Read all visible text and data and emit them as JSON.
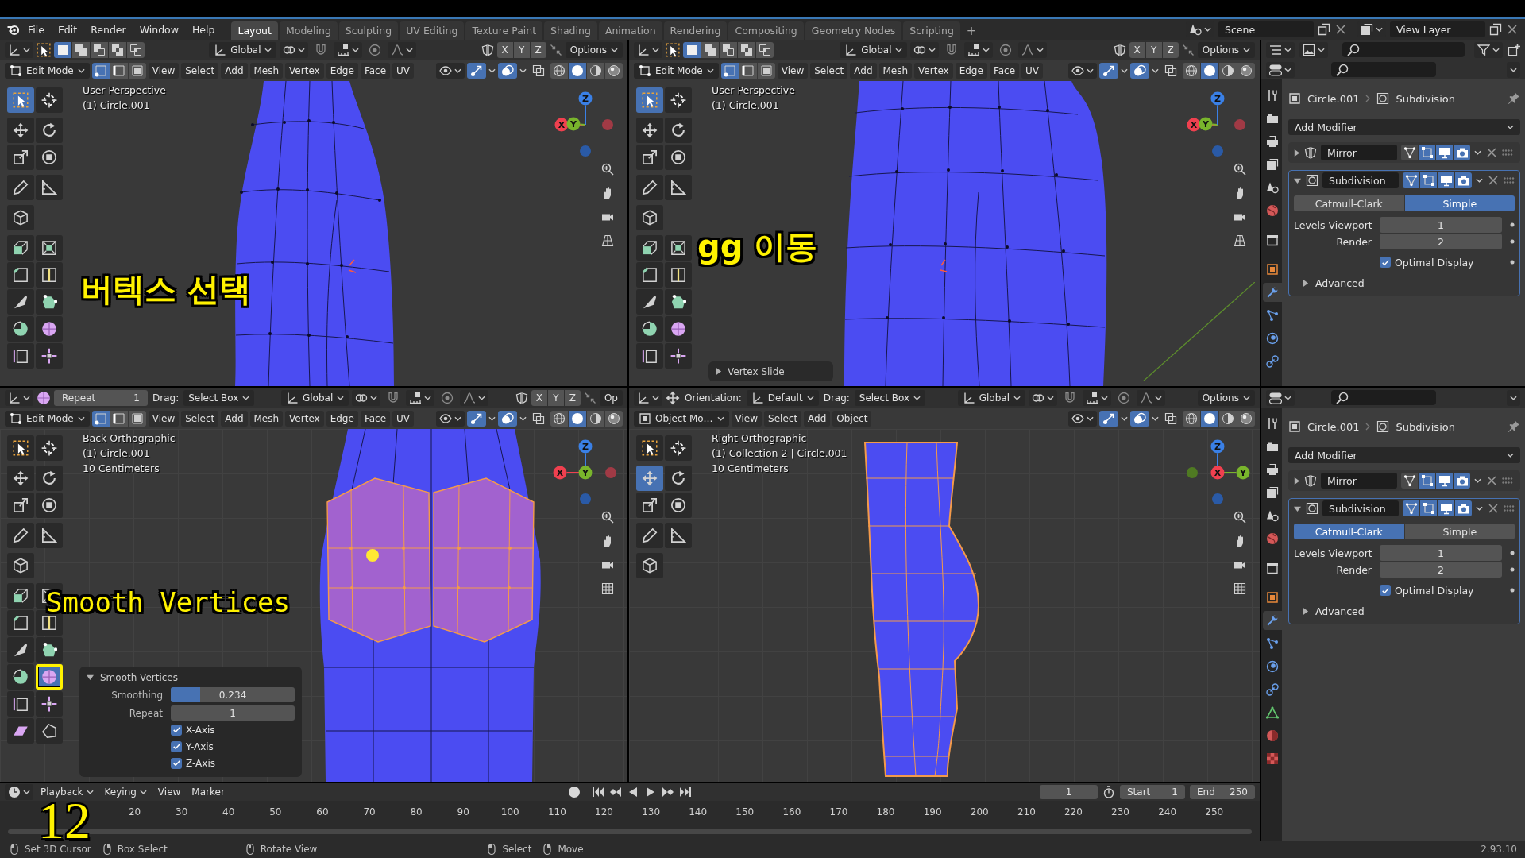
{
  "top_bar": {
    "menus": [
      "File",
      "Edit",
      "Render",
      "Window",
      "Help"
    ],
    "workspaces": [
      {
        "label": "Layout",
        "selected": true
      },
      {
        "label": "Modeling",
        "selected": false
      },
      {
        "label": "Sculpting",
        "selected": false
      },
      {
        "label": "UV Editing",
        "selected": false
      },
      {
        "label": "Texture Paint",
        "selected": false
      },
      {
        "label": "Shading",
        "selected": false
      },
      {
        "label": "Animation",
        "selected": false
      },
      {
        "label": "Rendering",
        "selected": false
      },
      {
        "label": "Compositing",
        "selected": false
      },
      {
        "label": "Geometry Nodes",
        "selected": false
      },
      {
        "label": "Scripting",
        "selected": false
      }
    ],
    "add_workspace": "+",
    "scene": "Scene",
    "view_layer": "View Layer"
  },
  "viewports": [
    {
      "kind": "perspective",
      "tool_settings": {
        "left": [
          {
            "kind": "editor"
          },
          {
            "kind": "tool"
          },
          {
            "kind": "select_set",
            "items": [
              {
                "kind": "set",
                "selected": true
              },
              {
                "kind": "extend",
                "selected": false
              },
              {
                "kind": "subtract",
                "selected": false
              },
              {
                "kind": "invert",
                "selected": false
              },
              {
                "kind": "intersect",
                "selected": false
              }
            ]
          }
        ],
        "center": [
          {
            "kind": "orientation",
            "text": "Global"
          },
          {
            "kind": "pivot"
          },
          {
            "kind": "snap",
            "on": false
          },
          {
            "kind": "proportional",
            "on": false
          }
        ],
        "right": [
          {
            "kind": "mirror"
          },
          {
            "kind": "axes",
            "items": [
              {
                "label": "X",
                "on": false
              },
              {
                "label": "Y",
                "on": false
              },
              {
                "label": "Z",
                "on": false
              }
            ]
          },
          {
            "kind": "auto_merge"
          },
          {
            "kind": "dropdown",
            "text": "Options"
          }
        ]
      },
      "header": {
        "mode": {
          "kind": "edit",
          "text": "Edit Mode"
        },
        "select_modes": [
          {
            "kind": "vertex",
            "selected": true
          },
          {
            "kind": "edge",
            "selected": false
          },
          {
            "kind": "face",
            "selected": false
          }
        ],
        "menus": [
          "View",
          "Select",
          "Add",
          "Mesh",
          "Vertex",
          "Edge",
          "Face",
          "UV"
        ],
        "toggles": [
          {
            "kind": "gizmo",
            "on": true
          },
          {
            "kind": "overlays",
            "on": true
          },
          {
            "kind": "xray",
            "on": false
          }
        ],
        "shading": [
          {
            "kind": "wireframe",
            "selected": false
          },
          {
            "kind": "solid",
            "selected": true
          },
          {
            "kind": "material",
            "selected": false
          },
          {
            "kind": "rendered",
            "selected": false
          }
        ]
      },
      "info": [
        "User Perspective",
        "(1) Circle.001"
      ],
      "gizmo": [
        {
          "kind": "neg_z",
          "color": "#2a5aa6"
        },
        {
          "kind": "neg_x",
          "color": "#a03a45"
        },
        {
          "kind": "x",
          "label": "X",
          "color": "#f0404f"
        },
        {
          "kind": "y",
          "label": "Y",
          "color": "#79b52c"
        },
        {
          "kind": "z",
          "label": "Z",
          "color": "#3a80e6"
        }
      ],
      "tools": [
        {
          "kind": "select",
          "selected": true
        },
        {
          "kind": "cursor",
          "selected": false
        },
        {
          "kind": "move",
          "selected": false
        },
        {
          "kind": "rotate",
          "selected": false
        },
        {
          "kind": "scale",
          "selected": false
        },
        {
          "kind": "transform",
          "selected": false
        },
        {
          "kind": "annotate",
          "selected": false
        },
        {
          "kind": "measure",
          "selected": false
        },
        {
          "kind": "add_cube",
          "selected": false
        },
        {
          "kind": "extrude",
          "selected": false
        },
        {
          "kind": "inset",
          "selected": false
        },
        {
          "kind": "bevel",
          "selected": false
        },
        {
          "kind": "loop_cut",
          "selected": false
        },
        {
          "kind": "knife",
          "selected": false
        },
        {
          "kind": "poly_build",
          "selected": false
        },
        {
          "kind": "spin",
          "selected": false
        },
        {
          "kind": "smooth",
          "selected": false
        },
        {
          "kind": "edge_slide",
          "selected": false
        },
        {
          "kind": "shrink",
          "selected": false
        }
      ],
      "caption": "버텍스 선택"
    },
    {
      "kind": "perspective",
      "tool_settings": {
        "left": [
          {
            "kind": "editor"
          },
          {
            "kind": "tool"
          },
          {
            "kind": "select_set",
            "items": [
              {
                "kind": "set",
                "selected": true
              },
              {
                "kind": "extend",
                "selected": false
              },
              {
                "kind": "subtract",
                "selected": false
              },
              {
                "kind": "invert",
                "selected": false
              },
              {
                "kind": "intersect",
                "selected": false
              }
            ]
          }
        ],
        "center": [
          {
            "kind": "orientation",
            "text": "Global"
          },
          {
            "kind": "pivot"
          },
          {
            "kind": "snap",
            "on": false
          },
          {
            "kind": "proportional",
            "on": false
          }
        ],
        "right": [
          {
            "kind": "mirror"
          },
          {
            "kind": "axes",
            "items": [
              {
                "label": "X",
                "on": false
              },
              {
                "label": "Y",
                "on": false
              },
              {
                "label": "Z",
                "on": false
              }
            ]
          },
          {
            "kind": "auto_merge"
          },
          {
            "kind": "dropdown",
            "text": "Options"
          }
        ]
      },
      "header": {
        "mode": {
          "kind": "edit",
          "text": "Edit Mode"
        },
        "select_modes": [
          {
            "kind": "vertex",
            "selected": true
          },
          {
            "kind": "edge",
            "selected": false
          },
          {
            "kind": "face",
            "selected": false
          }
        ],
        "menus": [
          "View",
          "Select",
          "Add",
          "Mesh",
          "Vertex",
          "Edge",
          "Face",
          "UV"
        ],
        "toggles": [
          {
            "kind": "gizmo",
            "on": true
          },
          {
            "kind": "overlays",
            "on": true
          },
          {
            "kind": "xray",
            "on": false
          }
        ],
        "shading": [
          {
            "kind": "wireframe",
            "selected": false
          },
          {
            "kind": "solid",
            "selected": true
          },
          {
            "kind": "material",
            "selected": false
          },
          {
            "kind": "rendered",
            "selected": false
          }
        ]
      },
      "info": [
        "User Perspective",
        "(1) Circle.001"
      ],
      "gizmo": [
        {
          "kind": "neg_z",
          "color": "#2a5aa6"
        },
        {
          "kind": "neg_x",
          "color": "#a03a45"
        },
        {
          "kind": "x",
          "label": "X",
          "color": "#f0404f"
        },
        {
          "kind": "y",
          "label": "Y",
          "color": "#79b52c"
        },
        {
          "kind": "z",
          "label": "Z",
          "color": "#3a80e6"
        }
      ],
      "tools": [
        {
          "kind": "select",
          "selected": true
        },
        {
          "kind": "cursor",
          "selected": false
        },
        {
          "kind": "move",
          "selected": false
        },
        {
          "kind": "rotate",
          "selected": false
        },
        {
          "kind": "scale",
          "selected": false
        },
        {
          "kind": "transform",
          "selected": false
        },
        {
          "kind": "annotate",
          "selected": false
        },
        {
          "kind": "measure",
          "selected": false
        },
        {
          "kind": "add_cube",
          "selected": false
        },
        {
          "kind": "extrude",
          "selected": false
        },
        {
          "kind": "inset",
          "selected": false
        },
        {
          "kind": "bevel",
          "selected": false
        },
        {
          "kind": "loop_cut",
          "selected": false
        },
        {
          "kind": "knife",
          "selected": false
        },
        {
          "kind": "poly_build",
          "selected": false
        },
        {
          "kind": "spin",
          "selected": false
        },
        {
          "kind": "smooth",
          "selected": false
        },
        {
          "kind": "edge_slide",
          "selected": false
        },
        {
          "kind": "shrink",
          "selected": false
        }
      ],
      "caption": "gg 이동",
      "operator": {
        "title": "Vertex Slide",
        "expanded": false
      }
    },
    {
      "kind": "back",
      "tool_settings": {
        "left": [
          {
            "kind": "editor"
          },
          {
            "kind": "tool"
          },
          {
            "kind": "field",
            "label": "Repeat",
            "value": "1"
          },
          {
            "kind": "label",
            "text": "Drag:"
          },
          {
            "kind": "dropdown",
            "text": "Select Box"
          }
        ],
        "center": [
          {
            "kind": "orientation",
            "text": "Global"
          },
          {
            "kind": "pivot"
          },
          {
            "kind": "snap",
            "on": false
          },
          {
            "kind": "proportional",
            "on": false
          }
        ],
        "right": [
          {
            "kind": "mirror"
          },
          {
            "kind": "axes",
            "items": [
              {
                "label": "X",
                "on": false
              },
              {
                "label": "Y",
                "on": false
              },
              {
                "label": "Z",
                "on": false
              }
            ]
          },
          {
            "kind": "auto_merge"
          },
          {
            "kind": "button",
            "text": "Op"
          }
        ]
      },
      "header": {
        "mode": {
          "kind": "edit",
          "text": "Edit Mode"
        },
        "select_modes": [
          {
            "kind": "vertex",
            "selected": true
          },
          {
            "kind": "edge",
            "selected": false
          },
          {
            "kind": "face",
            "selected": false
          }
        ],
        "menus": [
          "View",
          "Select",
          "Add",
          "Mesh",
          "Vertex",
          "Edge",
          "Face",
          "UV"
        ],
        "toggles": [
          {
            "kind": "gizmo",
            "on": true
          },
          {
            "kind": "overlays",
            "on": true
          },
          {
            "kind": "xray",
            "on": false
          }
        ],
        "shading": [
          {
            "kind": "wireframe",
            "selected": false
          },
          {
            "kind": "solid",
            "selected": true
          },
          {
            "kind": "material",
            "selected": false
          },
          {
            "kind": "rendered",
            "selected": false
          }
        ]
      },
      "info": [
        "Back Orthographic",
        "(1) Circle.001",
        "10 Centimeters"
      ],
      "gizmo": [
        {
          "kind": "neg_z",
          "color": "#2a5aa6"
        },
        {
          "kind": "neg_x",
          "color": "#a03a45"
        },
        {
          "kind": "x",
          "label": "X",
          "color": "#f0404f"
        },
        {
          "kind": "z",
          "label": "Z",
          "color": "#3a80e6"
        },
        {
          "kind": "y",
          "label": "Y",
          "color": "#79b52c"
        }
      ],
      "tools": [
        {
          "kind": "select",
          "selected": false
        },
        {
          "kind": "cursor",
          "selected": false
        },
        {
          "kind": "move",
          "selected": false
        },
        {
          "kind": "rotate",
          "selected": false
        },
        {
          "kind": "scale",
          "selected": false
        },
        {
          "kind": "transform",
          "selected": false
        },
        {
          "kind": "annotate",
          "selected": false
        },
        {
          "kind": "measure",
          "selected": false
        },
        {
          "kind": "add_cube",
          "selected": false
        },
        {
          "kind": "extrude",
          "selected": false
        },
        {
          "kind": "inset",
          "selected": false
        },
        {
          "kind": "bevel",
          "selected": false
        },
        {
          "kind": "loop_cut",
          "selected": false
        },
        {
          "kind": "knife",
          "selected": false
        },
        {
          "kind": "poly_build",
          "selected": false
        },
        {
          "kind": "spin",
          "selected": false
        },
        {
          "kind": "smooth",
          "selected": true,
          "highlighted": true
        },
        {
          "kind": "edge_slide",
          "selected": false
        },
        {
          "kind": "shrink",
          "selected": false
        },
        {
          "kind": "shear",
          "selected": false
        },
        {
          "kind": "rip",
          "selected": false
        }
      ],
      "caption": "Smooth Vertices",
      "operator": {
        "title": "Smooth Vertices",
        "expanded": true,
        "rows": [
          {
            "kind": "slider",
            "label": "Smoothing",
            "value": "0.234",
            "level": 0.234
          },
          {
            "kind": "number",
            "label": "Repeat",
            "value": "1"
          },
          {
            "kind": "checkbox",
            "label": "X-Axis",
            "checked": true
          },
          {
            "kind": "checkbox",
            "label": "Y-Axis",
            "checked": true
          },
          {
            "kind": "checkbox",
            "label": "Z-Axis",
            "checked": true
          }
        ]
      }
    },
    {
      "kind": "right",
      "tool_settings": {
        "left": [
          {
            "kind": "editor"
          },
          {
            "kind": "tool"
          },
          {
            "kind": "label",
            "text": "Orientation:"
          },
          {
            "kind": "orientation",
            "text": "Default"
          },
          {
            "kind": "label",
            "text": "Drag:"
          },
          {
            "kind": "dropdown",
            "text": "Select Box"
          }
        ],
        "center": [
          {
            "kind": "orientation",
            "text": "Global"
          },
          {
            "kind": "pivot"
          },
          {
            "kind": "snap",
            "on": false
          },
          {
            "kind": "proportional",
            "on": false
          }
        ],
        "right": [
          {
            "kind": "dropdown",
            "text": "Options"
          }
        ]
      },
      "header": {
        "mode": {
          "kind": "object",
          "text": "Object Mo…"
        },
        "menus": [
          "View",
          "Select",
          "Add",
          "Object"
        ],
        "toggles": [
          {
            "kind": "gizmo",
            "on": true
          },
          {
            "kind": "overlays",
            "on": true
          },
          {
            "kind": "xray",
            "on": false
          }
        ],
        "shading": [
          {
            "kind": "wireframe",
            "selected": false
          },
          {
            "kind": "solid",
            "selected": true
          },
          {
            "kind": "material",
            "selected": false
          },
          {
            "kind": "rendered",
            "selected": false
          }
        ]
      },
      "info": [
        "Right Orthographic",
        "(1) Collection 2 | Circle.001",
        "10 Centimeters"
      ],
      "gizmo": [
        {
          "kind": "neg_z",
          "color": "#2a5aa6"
        },
        {
          "kind": "neg_y",
          "color": "#4f7a22"
        },
        {
          "kind": "y",
          "label": "Y",
          "color": "#79b52c"
        },
        {
          "kind": "z",
          "label": "Z",
          "color": "#3a80e6"
        },
        {
          "kind": "x",
          "label": "X",
          "color": "#f0404f"
        }
      ],
      "tools": [
        {
          "kind": "select",
          "selected": false
        },
        {
          "kind": "cursor",
          "selected": false
        },
        {
          "kind": "move",
          "selected": true
        },
        {
          "kind": "rotate",
          "selected": false
        },
        {
          "kind": "scale",
          "selected": false
        },
        {
          "kind": "transform",
          "selected": false
        },
        {
          "kind": "annotate",
          "selected": false
        },
        {
          "kind": "measure",
          "selected": false
        },
        {
          "kind": "add_cube",
          "selected": false
        }
      ]
    }
  ],
  "properties": [
    {
      "tabs": [
        {
          "kind": "tool",
          "selected": false
        },
        {
          "kind": "render",
          "selected": false
        },
        {
          "kind": "output",
          "selected": false
        },
        {
          "kind": "view_layer",
          "selected": false
        },
        {
          "kind": "scene",
          "selected": false
        },
        {
          "kind": "world",
          "selected": false
        },
        {
          "kind": "collection",
          "selected": false
        },
        {
          "kind": "object",
          "selected": false
        },
        {
          "kind": "modifier",
          "selected": true
        },
        {
          "kind": "particles",
          "selected": false
        },
        {
          "kind": "physics",
          "selected": false
        },
        {
          "kind": "constraints",
          "selected": false
        }
      ],
      "object": "Circle.001",
      "modifier": "Subdivision",
      "add_modifier": "Add Modifier",
      "modifiers": [
        {
          "kind": "mirror",
          "name": "Mirror",
          "expanded": false,
          "active": false,
          "toggles": [
            {
              "kind": "on_cage",
              "on": false
            },
            {
              "kind": "edit_mode",
              "on": true
            },
            {
              "kind": "viewport",
              "on": true
            },
            {
              "kind": "render",
              "on": true
            }
          ]
        },
        {
          "kind": "subdivision",
          "name": "Subdivision",
          "expanded": true,
          "active": true,
          "toggles": [
            {
              "kind": "on_cage",
              "on": true
            },
            {
              "kind": "edit_mode",
              "on": true
            },
            {
              "kind": "viewport",
              "on": true
            },
            {
              "kind": "render",
              "on": true
            }
          ],
          "algorithms": [
            {
              "label": "Catmull-Clark",
              "selected": false
            },
            {
              "label": "Simple",
              "selected": true
            }
          ],
          "levels": [
            {
              "label": "Levels Viewport",
              "value": "1"
            },
            {
              "label": "Render",
              "value": "2"
            }
          ],
          "options": [
            {
              "label": "Optimal Display",
              "checked": true
            }
          ],
          "subpanels": [
            {
              "label": "Advanced",
              "expanded": false
            }
          ]
        }
      ]
    },
    {
      "tabs": [
        {
          "kind": "tool",
          "selected": false
        },
        {
          "kind": "render",
          "selected": false
        },
        {
          "kind": "output",
          "selected": false
        },
        {
          "kind": "view_layer",
          "selected": false
        },
        {
          "kind": "scene",
          "selected": false
        },
        {
          "kind": "world",
          "selected": false
        },
        {
          "kind": "collection",
          "selected": false
        },
        {
          "kind": "object",
          "selected": false
        },
        {
          "kind": "modifier",
          "selected": true
        },
        {
          "kind": "particles",
          "selected": false
        },
        {
          "kind": "physics",
          "selected": false
        },
        {
          "kind": "constraints",
          "selected": false
        },
        {
          "kind": "data",
          "selected": false
        },
        {
          "kind": "material",
          "selected": false
        },
        {
          "kind": "texture",
          "selected": false
        }
      ],
      "object": "Circle.001",
      "modifier": "Subdivision",
      "add_modifier": "Add Modifier",
      "modifiers": [
        {
          "kind": "mirror",
          "name": "Mirror",
          "expanded": false,
          "active": false,
          "toggles": [
            {
              "kind": "on_cage",
              "on": false
            },
            {
              "kind": "edit_mode",
              "on": true
            },
            {
              "kind": "viewport",
              "on": true
            },
            {
              "kind": "render",
              "on": true
            }
          ]
        },
        {
          "kind": "subdivision",
          "name": "Subdivision",
          "expanded": true,
          "active": true,
          "toggles": [
            {
              "kind": "on_cage",
              "on": true
            },
            {
              "kind": "edit_mode",
              "on": true
            },
            {
              "kind": "viewport",
              "on": true
            },
            {
              "kind": "render",
              "on": true
            }
          ],
          "algorithms": [
            {
              "label": "Catmull-Clark",
              "selected": true
            },
            {
              "label": "Simple",
              "selected": false
            }
          ],
          "levels": [
            {
              "label": "Levels Viewport",
              "value": "1"
            },
            {
              "label": "Render",
              "value": "2"
            }
          ],
          "options": [
            {
              "label": "Optimal Display",
              "checked": true
            }
          ],
          "subpanels": [
            {
              "label": "Advanced",
              "expanded": false
            }
          ]
        }
      ]
    }
  ],
  "timeline": {
    "menus": [
      {
        "label": "Playback",
        "kind": "dropdown"
      },
      {
        "label": "Keying",
        "kind": "dropdown"
      },
      {
        "label": "View",
        "kind": "menu"
      },
      {
        "label": "Marker",
        "kind": "menu"
      }
    ],
    "auto_keying": false,
    "current_frame": "1",
    "start": {
      "label": "Start",
      "value": "1"
    },
    "end": {
      "label": "End",
      "value": "250"
    },
    "ruler": [
      "20",
      "30",
      "40",
      "50",
      "60",
      "70",
      "80",
      "90",
      "100",
      "110",
      "120",
      "130",
      "140",
      "150",
      "160",
      "170",
      "180",
      "190",
      "200",
      "210",
      "220",
      "230",
      "240",
      "250"
    ]
  },
  "step_number": "12",
  "status_bar": {
    "hints": [
      {
        "kind": "left",
        "label": "Set 3D Cursor"
      },
      {
        "kind": "drag",
        "label": "Box Select"
      },
      {
        "kind": "middle",
        "label": "Rotate View"
      },
      {
        "kind": "left",
        "label": "Select"
      },
      {
        "kind": "drag",
        "label": "Move"
      }
    ],
    "version": "2.93.10"
  }
}
